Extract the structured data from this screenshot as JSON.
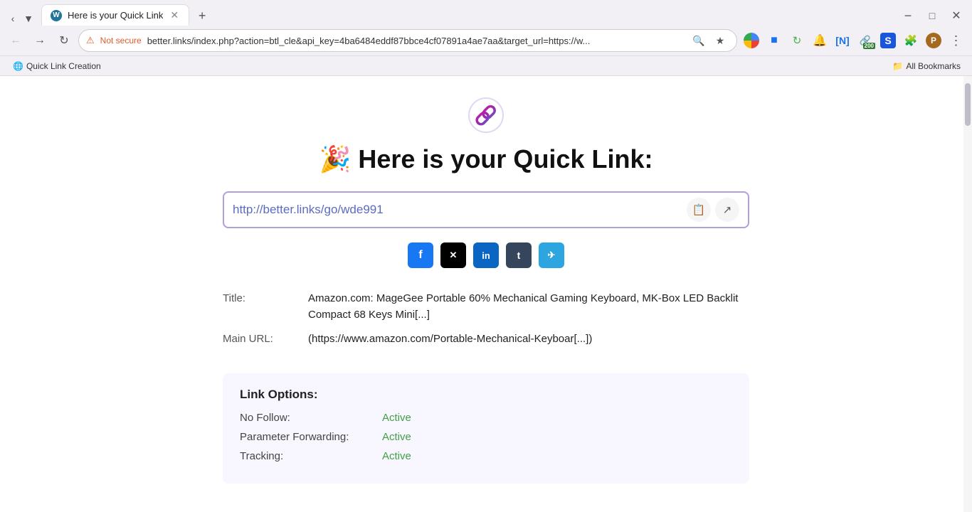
{
  "browser": {
    "tabs": [
      {
        "id": "tab1",
        "favicon_type": "wp",
        "title": "Here is your Quick Link",
        "active": true
      },
      {
        "id": "tab-new",
        "label": "+"
      }
    ],
    "address": {
      "not_secure_label": "Not secure",
      "url_display": "better.links/index.php?action=btl_cle&api_key=4ba6484eddf87bbce4cf07891a4ae7aa&target_url=https://w...",
      "url_full": "better.links/index.php?action=btl_cle&api_key=4ba6484eddf87bbce4cf07891a4ae7aa&target_url=https://w..."
    },
    "bookmarks": [
      {
        "label": "Quick Link Creation",
        "icon": "🔗"
      }
    ],
    "all_bookmarks_label": "All Bookmarks"
  },
  "page": {
    "logo_emoji": "🔗",
    "heading_emoji": "🎉",
    "heading_text": "Here is your Quick Link:",
    "link_url": "http://better.links/go/wde991",
    "copy_tooltip": "Copy",
    "open_tooltip": "Open",
    "social_share": {
      "facebook": "f",
      "x": "𝕏",
      "linkedin": "in",
      "tumblr": "t",
      "telegram": "✈"
    },
    "title_label": "Title:",
    "title_value": "Amazon.com: MageGee Portable 60% Mechanical Gaming Keyboard, MK-Box LED Backlit Compact 68 Keys Mini[...]",
    "main_url_label": "Main URL:",
    "main_url_value": "(https://www.amazon.com/Portable-Mechanical-Keyboar[...])",
    "link_options": {
      "title": "Link Options:",
      "no_follow_label": "No Follow:",
      "no_follow_value": "Active",
      "param_forwarding_label": "Parameter Forwarding:",
      "param_forwarding_value": "Active",
      "tracking_label": "Tracking:",
      "tracking_value": "Active"
    }
  }
}
